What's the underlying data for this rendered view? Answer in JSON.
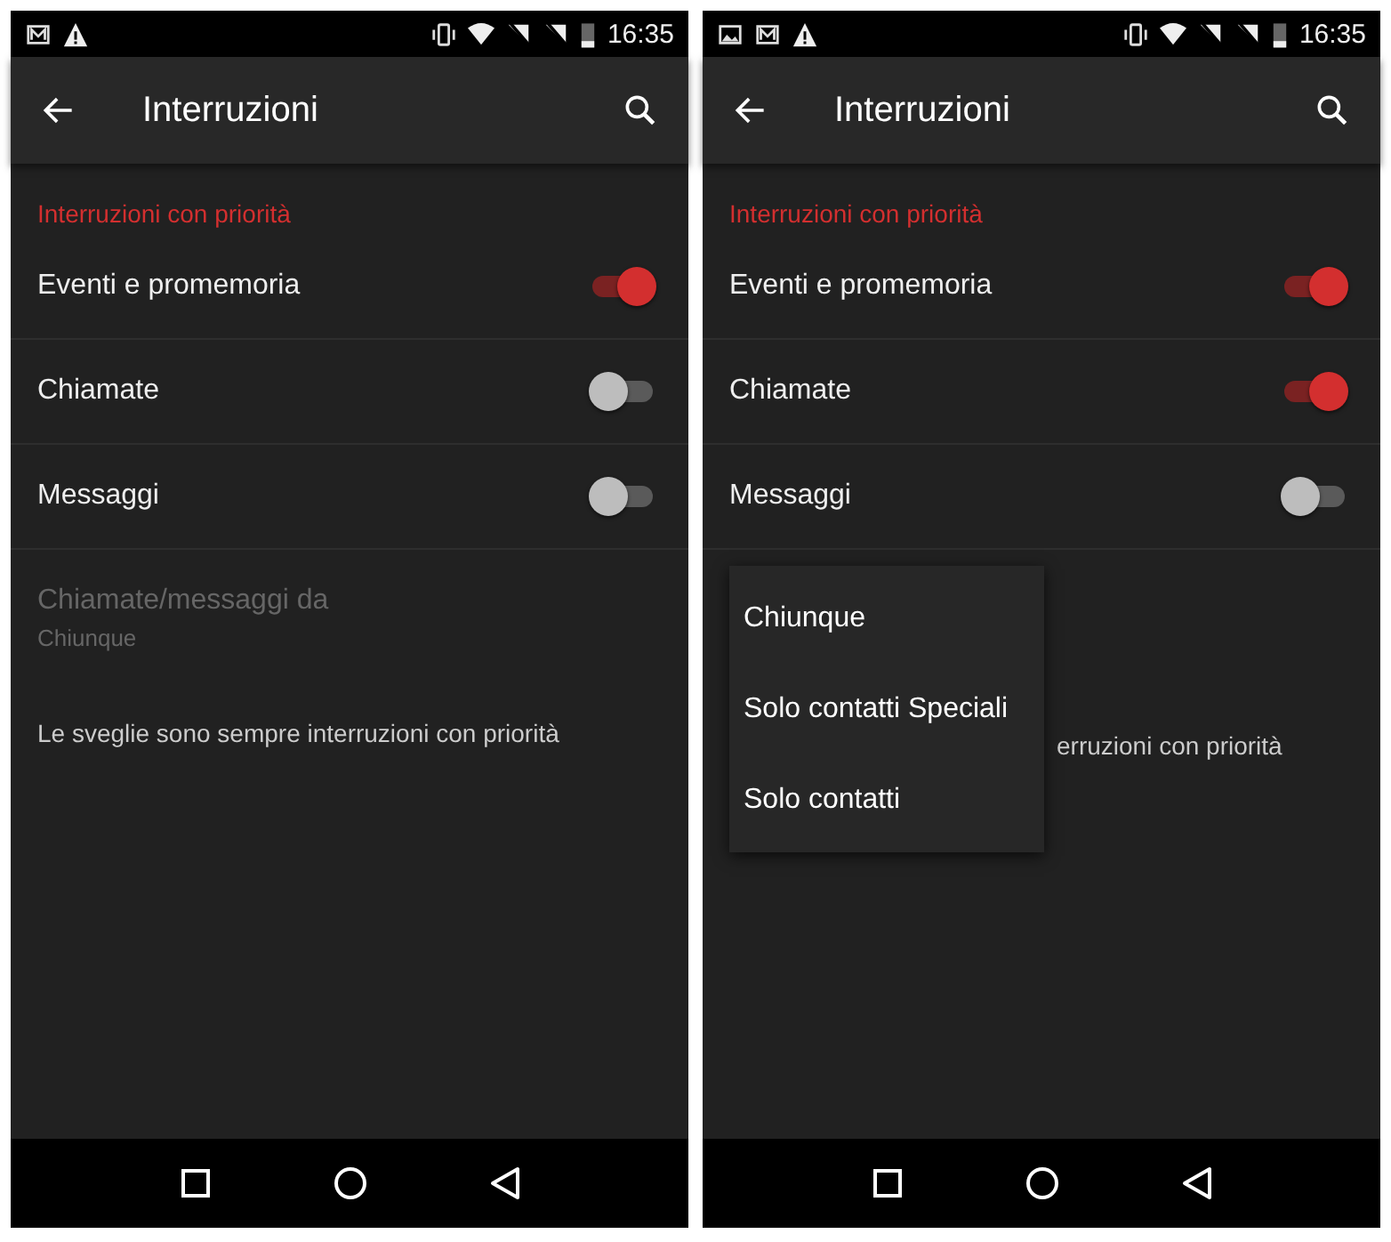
{
  "screens": [
    {
      "notifications": [
        {
          "kind": "mail"
        },
        {
          "kind": "warning"
        }
      ],
      "time": "16:35",
      "title": "Interruzioni",
      "section": "Interruzioni con priorità",
      "rows": [
        {
          "label": "Eventi e promemoria",
          "on": true
        },
        {
          "label": "Chiamate",
          "on": false
        },
        {
          "label": "Messaggi",
          "on": false
        }
      ],
      "setting": {
        "title": "Chiamate/messaggi da",
        "value": "Chiunque",
        "disabled": true
      },
      "note": "Le sveglie sono sempre interruzioni con priorità"
    },
    {
      "notifications": [
        {
          "kind": "picture"
        },
        {
          "kind": "mail"
        },
        {
          "kind": "warning"
        }
      ],
      "time": "16:35",
      "title": "Interruzioni",
      "section": "Interruzioni con priorità",
      "rows": [
        {
          "label": "Eventi e promemoria",
          "on": true
        },
        {
          "label": "Chiamate",
          "on": true
        },
        {
          "label": "Messaggi",
          "on": false
        }
      ],
      "note": "erruzioni con priorità",
      "menu": [
        "Chiunque",
        "Solo contatti Speciali",
        "Solo contatti"
      ]
    }
  ]
}
